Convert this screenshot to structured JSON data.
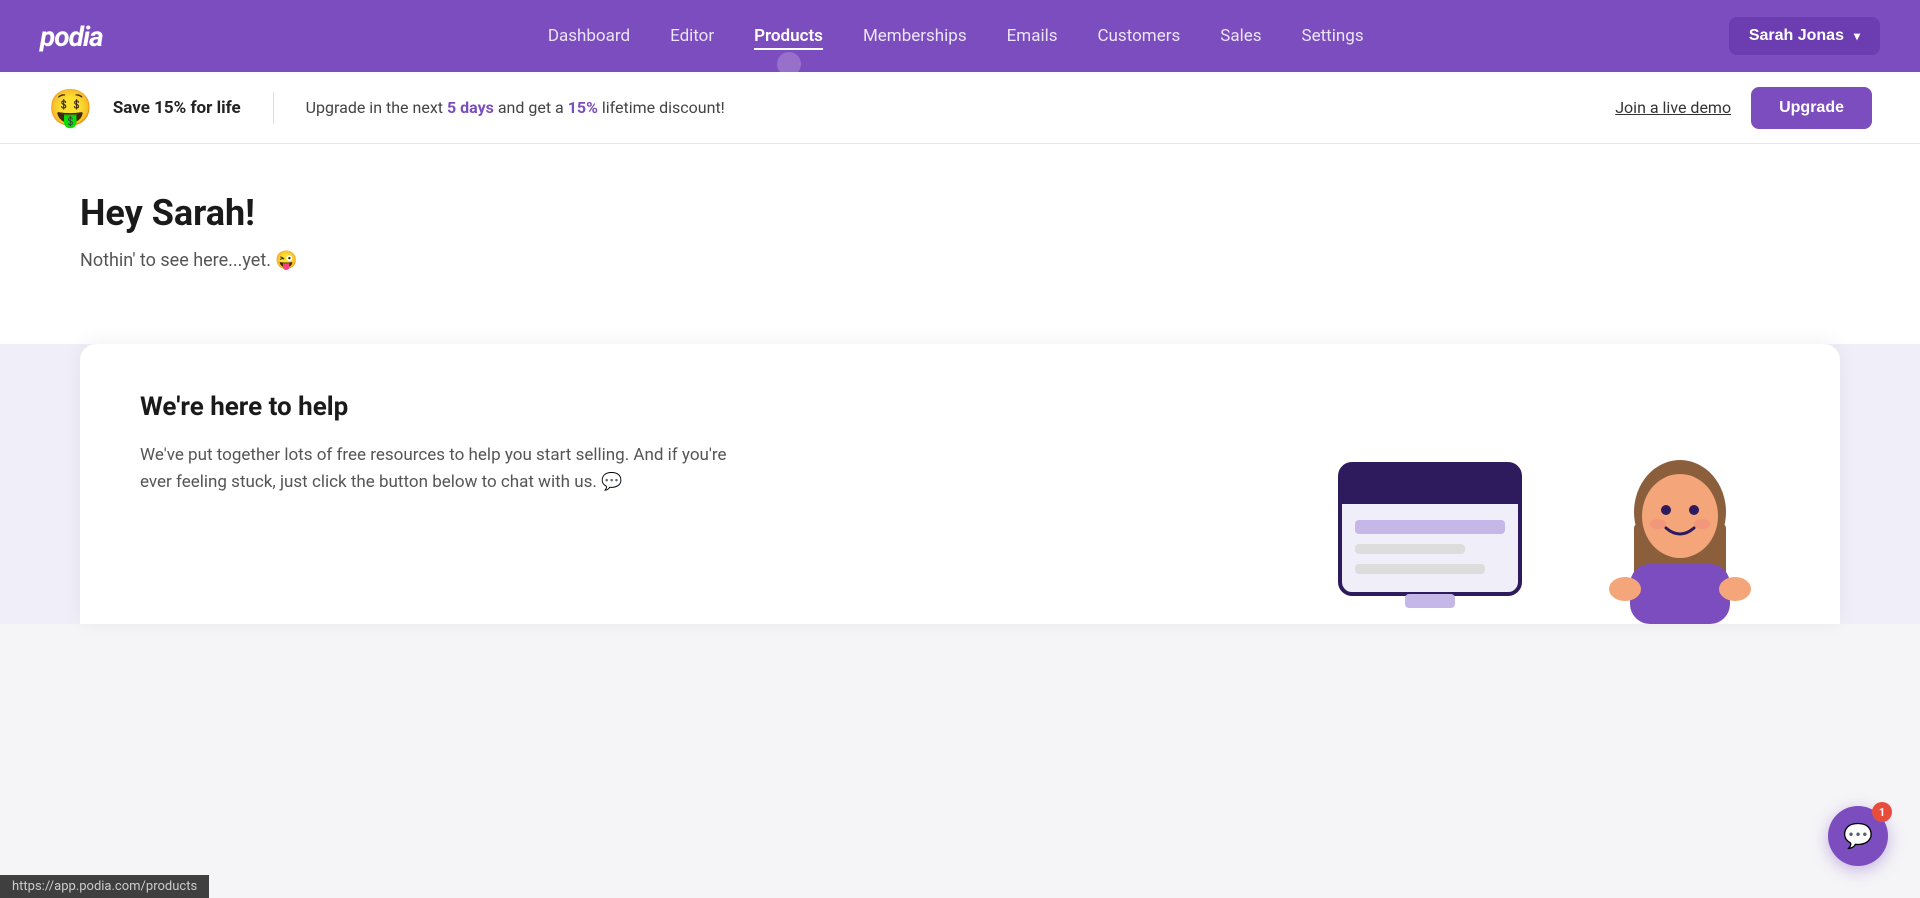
{
  "brand": {
    "name": "podia"
  },
  "nav": {
    "links": [
      {
        "id": "dashboard",
        "label": "Dashboard",
        "active": false
      },
      {
        "id": "editor",
        "label": "Editor",
        "active": false
      },
      {
        "id": "products",
        "label": "Products",
        "active": true
      },
      {
        "id": "memberships",
        "label": "Memberships",
        "active": false
      },
      {
        "id": "emails",
        "label": "Emails",
        "active": false
      },
      {
        "id": "customers",
        "label": "Customers",
        "active": false
      },
      {
        "id": "sales",
        "label": "Sales",
        "active": false
      },
      {
        "id": "settings",
        "label": "Settings",
        "active": false
      }
    ],
    "user": {
      "name": "Sarah Jonas",
      "button_label": "Sarah Jonas"
    }
  },
  "banner": {
    "emoji": "🤑",
    "title": "Save 15% for life",
    "text_before": "Upgrade in the next ",
    "days_highlight": "5 days",
    "text_middle": " and get a ",
    "pct_highlight": "15%",
    "text_after": " lifetime discount!",
    "link_label": "Join a live demo",
    "upgrade_label": "Upgrade"
  },
  "main": {
    "greeting": "Hey Sarah!",
    "subtitle": "Nothin' to see here...yet. 😜"
  },
  "help_section": {
    "title": "We're here to help",
    "description": "We've put together lots of free resources to help you start selling. And if you're ever feeling stuck, just click the button below to chat with us. 💬"
  },
  "chat": {
    "notification_count": "1",
    "icon": "💬"
  },
  "status_bar": {
    "url": "https://app.podia.com/products"
  }
}
